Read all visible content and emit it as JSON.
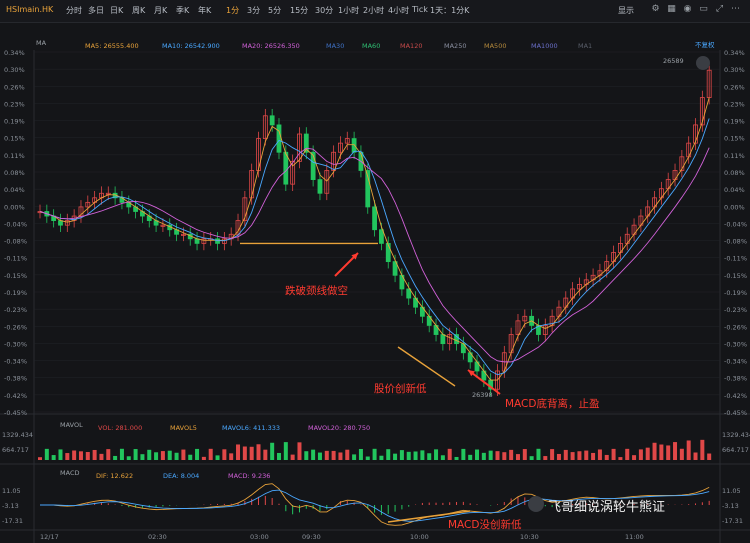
{
  "toolbar": {
    "symbol": "HSImain.HK",
    "periods": [
      "分时",
      "多日",
      "日K",
      "周K",
      "月K",
      "季K",
      "年K",
      "1分",
      "3分",
      "5分",
      "15分",
      "30分",
      "1小时",
      "2小时",
      "4小时",
      "Tick",
      "1天：1分K"
    ],
    "active_period": "1分",
    "display_label": "显示",
    "icons": [
      "settings-icon",
      "grid-icon",
      "camera-icon",
      "window-icon",
      "expand-icon",
      "more-icon"
    ]
  },
  "legend_ma": {
    "name": "MA",
    "items": [
      {
        "label": "MA5: 26555.400",
        "color": "#e8a23a"
      },
      {
        "label": "MA10: 26542.900",
        "color": "#4aa8ff"
      },
      {
        "label": "MA20: 26526.350",
        "color": "#d161d8"
      },
      {
        "label": "MA30",
        "color": "#3f72c7"
      },
      {
        "label": "MA60",
        "color": "#2fbf73"
      },
      {
        "label": "MA120",
        "color": "#c64a4a"
      },
      {
        "label": "MA250",
        "color": "#8a8fa0"
      },
      {
        "label": "MA500",
        "color": "#b58a3c"
      },
      {
        "label": "MA1000",
        "color": "#6a6fc9"
      },
      {
        "label": "MA1",
        "color": "#5a5f6a"
      }
    ],
    "right_label": "不复权"
  },
  "legend_vol": {
    "name": "MAVOL",
    "items": [
      {
        "label": "VOL: 281.000",
        "color": "#e04848"
      },
      {
        "label": "MAVOL5",
        "color": "#e8a23a"
      },
      {
        "label": "MAVOL6: 411.333",
        "color": "#4aa8ff"
      },
      {
        "label": "MAVOL20: 280.750",
        "color": "#d161d8"
      }
    ]
  },
  "legend_macd": {
    "name": "MACD",
    "items": [
      {
        "label": "DIF: 12.622",
        "color": "#e8a23a"
      },
      {
        "label": "DEA: 8.004",
        "color": "#4aa8ff"
      },
      {
        "label": "MACD: 9.236",
        "color": "#d161d8"
      }
    ]
  },
  "annotations": {
    "break": "跌破颈线做空",
    "new_low": "股价创新低",
    "divergence": "MACD底背离，止盈",
    "macd_no_low": "MACD没创新低"
  },
  "watermark": "飞哥细说涡轮牛熊证",
  "colors": {
    "up": "#e04848",
    "down": "#22c55e",
    "bg": "#141518",
    "grid": "#23252a",
    "orange_line": "#e8a23a",
    "arrow": "#ff3b30"
  },
  "chart_data": {
    "type": "candlestick",
    "price_axis_ticks": [
      "0.34%",
      "0.30%",
      "0.26%",
      "0.23%",
      "0.19%",
      "0.15%",
      "0.11%",
      "0.08%",
      "0.04%",
      "0.00%",
      "-0.04%",
      "-0.08%",
      "-0.11%",
      "-0.15%",
      "-0.19%",
      "-0.23%",
      "-0.26%",
      "-0.30%",
      "-0.34%",
      "-0.38%",
      "-0.42%",
      "-0.45%"
    ],
    "right_price_ticks": [
      "0.34%",
      "0.30%",
      "0.26%",
      "0.23%",
      "0.19%",
      "0.15%",
      "0.11%",
      "0.08%",
      "0.04%",
      "0.00%",
      "-0.04%",
      "-0.08%",
      "-0.11%",
      "-0.15%",
      "-0.19%",
      "-0.23%",
      "-0.26%",
      "-0.30%",
      "-0.34%",
      "-0.38%",
      "-0.42%",
      "-0.45%"
    ],
    "ylim_pct": [
      -0.45,
      0.34
    ],
    "x_ticks": [
      "12/17",
      "02:30",
      "03:00",
      "09:30",
      "10:00",
      "10:30",
      "11:00"
    ],
    "high_label": "26589",
    "low_label": "26398",
    "vol_ticks": [
      "1329.434",
      "664.717"
    ],
    "macd_ticks": [
      "11.05",
      "-3.13",
      "-17.31"
    ],
    "close_pct": [
      -0.01,
      -0.02,
      -0.03,
      -0.04,
      -0.03,
      -0.02,
      0.0,
      0.01,
      0.02,
      0.03,
      0.03,
      0.02,
      0.01,
      0.0,
      -0.01,
      -0.02,
      -0.03,
      -0.04,
      -0.04,
      -0.05,
      -0.06,
      -0.06,
      -0.07,
      -0.08,
      -0.07,
      -0.07,
      -0.08,
      -0.07,
      -0.06,
      -0.03,
      0.02,
      0.08,
      0.15,
      0.2,
      0.18,
      0.12,
      0.05,
      0.1,
      0.16,
      0.12,
      0.06,
      0.03,
      0.08,
      0.12,
      0.14,
      0.15,
      0.12,
      0.08,
      0.0,
      -0.05,
      -0.08,
      -0.12,
      -0.15,
      -0.18,
      -0.2,
      -0.22,
      -0.24,
      -0.26,
      -0.28,
      -0.3,
      -0.28,
      -0.3,
      -0.32,
      -0.34,
      -0.36,
      -0.38,
      -0.4,
      -0.36,
      -0.32,
      -0.28,
      -0.25,
      -0.24,
      -0.26,
      -0.28,
      -0.26,
      -0.24,
      -0.22,
      -0.2,
      -0.18,
      -0.17,
      -0.16,
      -0.15,
      -0.14,
      -0.12,
      -0.1,
      -0.08,
      -0.06,
      -0.04,
      -0.02,
      0.0,
      0.02,
      0.04,
      0.06,
      0.08,
      0.11,
      0.14,
      0.18,
      0.24,
      0.3
    ],
    "neckline_pct": -0.08,
    "volume_series": "per-bar volume, max 1329.434",
    "macd_series": "DIF / DEA / histogram"
  }
}
